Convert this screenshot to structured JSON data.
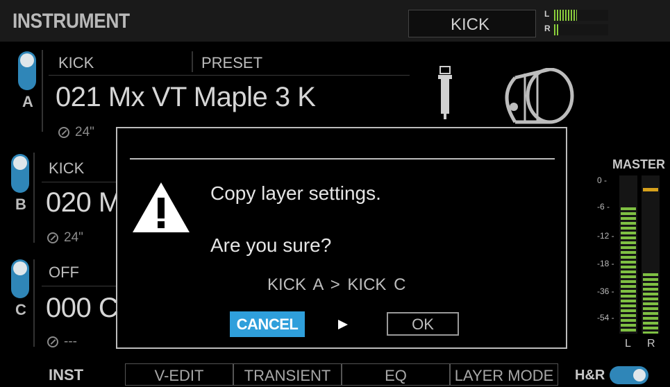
{
  "header": {
    "title": "INSTRUMENT",
    "kit_pad": "KICK",
    "meter": {
      "left_label": "L",
      "right_label": "R",
      "left_level": 0.42,
      "right_level": 0.1
    }
  },
  "layers": [
    {
      "letter": "A",
      "toggle_on": true,
      "category": "KICK",
      "preset_label": "PRESET",
      "name": "021 Mx VT Maple 3 K",
      "size": "24\""
    },
    {
      "letter": "B",
      "toggle_on": true,
      "category": "KICK",
      "name": "020 M",
      "size": "24\""
    },
    {
      "letter": "C",
      "toggle_on": true,
      "category": "OFF",
      "name": "000 C",
      "size": "---"
    }
  ],
  "master": {
    "label": "MASTER",
    "scale": [
      "0 -",
      "-6 -",
      "-12 -",
      "-18 -",
      "-36 -",
      "-54 -"
    ],
    "left_label": "L",
    "right_label": "R",
    "left_level": 0.8,
    "right_level": 0.38,
    "right_peak": 0.9
  },
  "dialog": {
    "message": "Copy layer settings.",
    "question": "Are you sure?",
    "copy_desc": "KICK A  >  KICK C",
    "cancel_label": "CANCEL",
    "ok_label": "OK"
  },
  "tabs": {
    "inst": "INST",
    "items": [
      "V-EDIT",
      "TRANSIENT",
      "EQ",
      "LAYER MODE"
    ],
    "hr_label": "H&R",
    "hr_on": true
  },
  "colors": {
    "accent": "#2f9fdb",
    "toggle": "#2f86b8",
    "meter_green": "#7fc043",
    "meter_peak": "#d6a11c"
  }
}
